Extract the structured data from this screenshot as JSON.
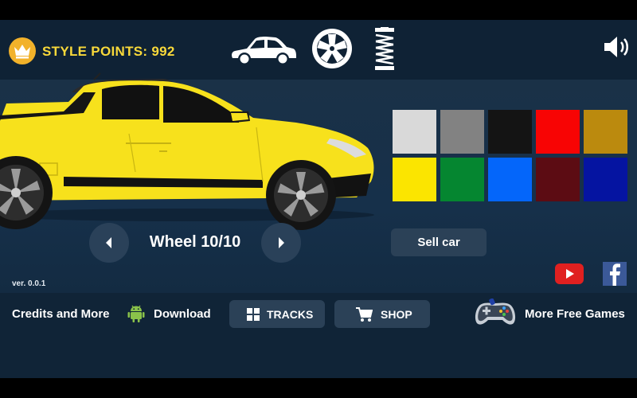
{
  "header": {
    "style_points_label": "STYLE POINTS: 992",
    "tabs": [
      {
        "name": "car-body-tab",
        "icon": "car-icon"
      },
      {
        "name": "wheel-tab",
        "icon": "rim-icon"
      },
      {
        "name": "suspension-tab",
        "icon": "spring-icon"
      }
    ],
    "sound_icon": "speaker-icon"
  },
  "car": {
    "paint_color": "#f7e11c",
    "wheel_label": "Wheel 10/10"
  },
  "colors": {
    "palette": [
      "#d9d9d9",
      "#828282",
      "#141414",
      "#f80404",
      "#bb8a0e",
      "#fbe500",
      "#058630",
      "#0466fa",
      "#5c0c13",
      "#0514a1"
    ]
  },
  "actions": {
    "sell_label": "Sell car"
  },
  "footer": {
    "version": "ver. 0.0.1",
    "credits_label": "Credits and More",
    "download_label": "Download",
    "tracks_label": "TRACKS",
    "shop_label": "SHOP",
    "more_games_label": "More Free Games"
  },
  "social": {
    "youtube_color": "#e02020",
    "facebook_color": "#3b5998"
  },
  "theme": {
    "accent_yellow": "#f9d93a",
    "background": "#12283d"
  }
}
